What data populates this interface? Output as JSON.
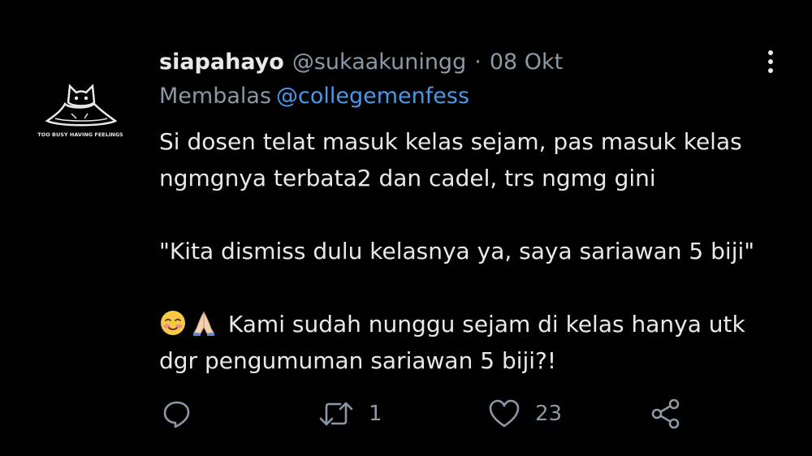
{
  "tweet": {
    "display_name": "siapahayo",
    "handle": "@sukaakuningg",
    "separator": "·",
    "date": "08 Okt",
    "reply_prefix": "Membalas",
    "reply_mention": "@collegemenfess",
    "avatar_caption": "TOO BUSY HAVING FEELINGS",
    "body_line1": "Si dosen telat masuk kelas sejam, pas masuk kelas",
    "body_line2": "ngmgnya terbata2 dan cadel, trs ngmg gini",
    "body_line3": "\"Kita dismiss dulu kelasnya ya, saya sariawan 5 biji\"",
    "body_line4_text": "Kami sudah nunggu sejam di kelas hanya utk",
    "body_line5": "dgr pengumuman sariawan 5 biji?!",
    "emojis": [
      "smiling-face-with-blush-emoji",
      "folded-hands-emoji"
    ],
    "retweet_count": "1",
    "like_count": "23"
  },
  "icons": {
    "reply": "reply-bubble-icon",
    "retweet": "retweet-arrows-icon",
    "like": "heart-icon",
    "share": "share-icon",
    "more": "more-vertical-icon"
  },
  "colors": {
    "background": "#000000",
    "text_primary": "#e7e9ea",
    "text_secondary": "#8b98a5",
    "link": "#4a99e9"
  }
}
